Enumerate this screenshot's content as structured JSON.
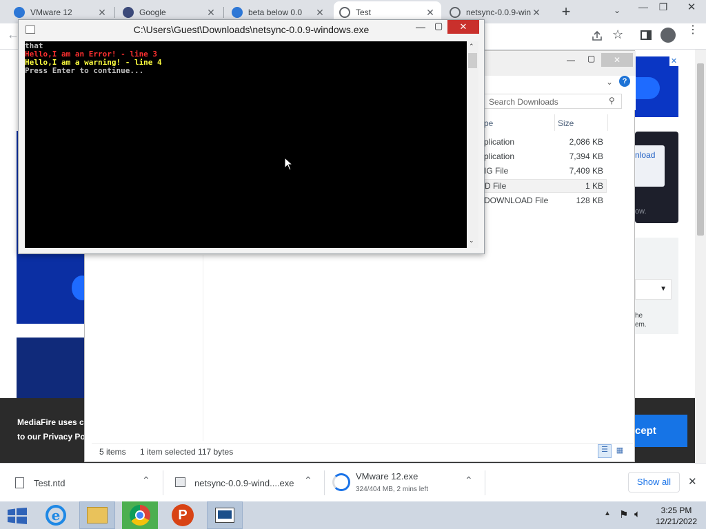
{
  "browser": {
    "tabs": [
      {
        "label": "VMware 12",
        "icon": "vmware-icon"
      },
      {
        "label": "Google",
        "icon": "google-icon"
      },
      {
        "label": "beta below 0.0",
        "icon": "vmware-icon"
      },
      {
        "label": "Test",
        "icon": "globe-icon"
      },
      {
        "label": "netsync-0.0.9-win",
        "icon": "globe-icon"
      }
    ],
    "new_tab": "+",
    "tab_close": "✕"
  },
  "console": {
    "title": "C:\\Users\\Guest\\Downloads\\netsync-0.0.9-windows.exe",
    "lines": [
      {
        "text": "that",
        "color": "#c0c0c0"
      },
      {
        "text": "Hello,I am an Error!  - line 3",
        "color": "#ff3030"
      },
      {
        "text": "Hello,I am a warning! - line 4",
        "color": "#ffff40"
      },
      {
        "text": "Press Enter to continue...",
        "color": "#c0c0c0"
      }
    ]
  },
  "explorer": {
    "search_placeholder": "Search Downloads",
    "columns": {
      "type": "pe",
      "size": "Size"
    },
    "rows": [
      {
        "type": "plication",
        "size": "2,086 KB"
      },
      {
        "type": "plication",
        "size": "7,394 KB"
      },
      {
        "type": "IG File",
        "size": "7,409 KB"
      },
      {
        "type": "D File",
        "size": "1 KB"
      },
      {
        "type": "DOWNLOAD File",
        "size": "128 KB"
      }
    ],
    "status_items": "5 items",
    "status_selected": "1 item selected  117 bytes"
  },
  "page": {
    "download_btn": "nload",
    "side_text_1": "ow.",
    "side_text_2": "he",
    "side_text_3": "em.",
    "cookie_line1": "MediaFire uses c",
    "cookie_line2": "to our Privacy Po",
    "accept_btn": "cept"
  },
  "shelf": {
    "items": [
      {
        "name": "Test.ntd",
        "sub": ""
      },
      {
        "name": "netsync-0.0.9-wind....exe",
        "sub": ""
      },
      {
        "name": "VMware 12.exe",
        "sub": "324/404 MB, 2 mins left"
      }
    ],
    "show_all": "Show all",
    "close": "✕"
  },
  "taskbar": {
    "time": "3:25 PM",
    "date": "12/21/2022"
  }
}
